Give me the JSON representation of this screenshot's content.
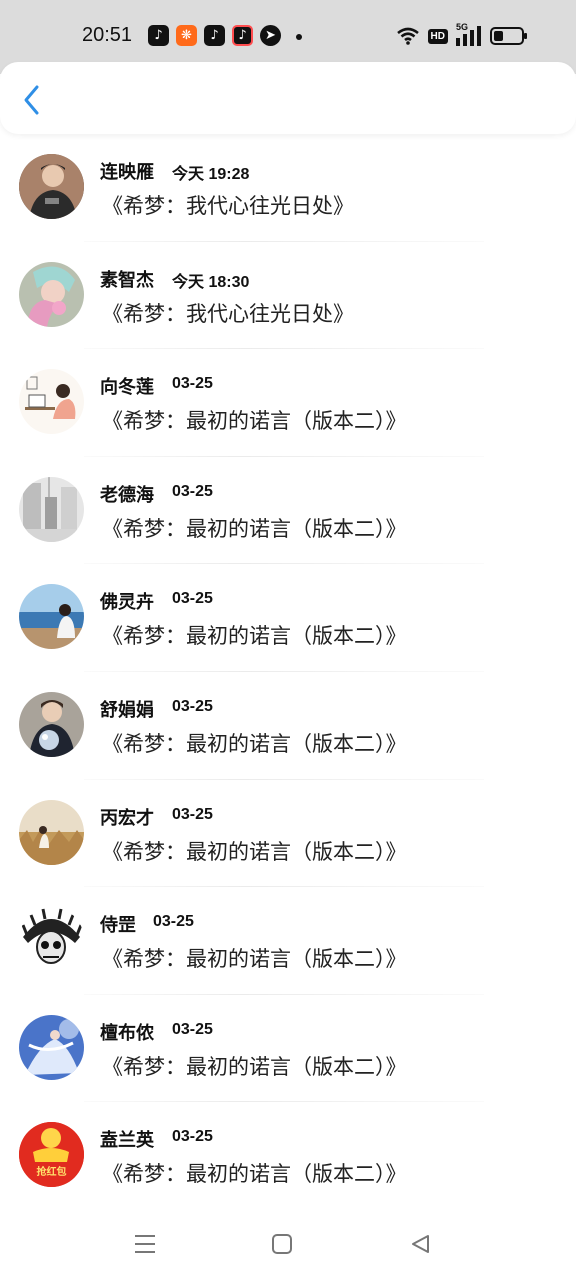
{
  "status_bar": {
    "time": "20:51",
    "network": "5G",
    "hd": "HD"
  },
  "header": {
    "back_icon": "chevron-left-icon"
  },
  "colors": {
    "accent": "#1e88e5",
    "status_bar_bg": "#dcdcdc"
  },
  "items": [
    {
      "name": "连映雁",
      "date": "今天 19:28",
      "message": "《希梦：我代心往光日处》",
      "avatar": "avatar-person-dark-shirt"
    },
    {
      "name": "素智杰",
      "date": "今天 18:30",
      "message": "《希梦：我代心往光日处》",
      "avatar": "avatar-pink-hair-girl"
    },
    {
      "name": "向冬莲",
      "date": "03-25",
      "message": "《希梦：最初的诺言（版本二）》",
      "avatar": "avatar-drawing-desk"
    },
    {
      "name": "老德海",
      "date": "03-25",
      "message": "《希梦：最初的诺言（版本二）》",
      "avatar": "avatar-grey-street"
    },
    {
      "name": "佛灵卉",
      "date": "03-25",
      "message": "《希梦：最初的诺言（版本二）》",
      "avatar": "avatar-seaside-girl"
    },
    {
      "name": "舒娟娟",
      "date": "03-25",
      "message": "《希梦：最初的诺言（版本二）》",
      "avatar": "avatar-suit-flowers"
    },
    {
      "name": "丙宏才",
      "date": "03-25",
      "message": "《希梦：最初的诺言（版本二）》",
      "avatar": "avatar-grass-field"
    },
    {
      "name": "侍罡",
      "date": "03-25",
      "message": "《希梦：最初的诺言（版本二）》",
      "avatar": "avatar-skull-headdress"
    },
    {
      "name": "檀布侬",
      "date": "03-25",
      "message": "《希梦：最初的诺言（版本二）》",
      "avatar": "avatar-blue-dancer"
    },
    {
      "name": "盍兰英",
      "date": "03-25",
      "message": "《希梦：最初的诺言（版本二）》",
      "avatar": "avatar-red-envelope",
      "avatar_text": "抢红包"
    }
  ],
  "nav": {
    "menu_icon": "menu-icon",
    "home_icon": "home-square-icon",
    "back_icon": "back-triangle-icon"
  }
}
